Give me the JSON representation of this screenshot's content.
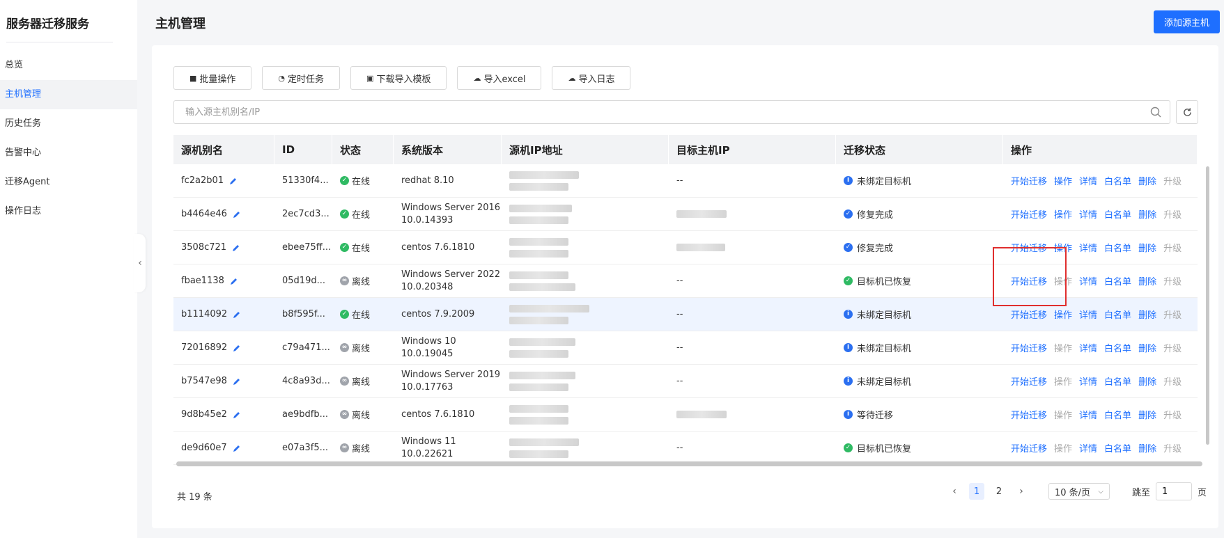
{
  "app_title": "服务器迁移服务",
  "sidebar": {
    "items": [
      {
        "label": "总览"
      },
      {
        "label": "主机管理"
      },
      {
        "label": "历史任务"
      },
      {
        "label": "告警中心"
      },
      {
        "label": "迁移Agent"
      },
      {
        "label": "操作日志"
      }
    ],
    "active_index": 1
  },
  "header": {
    "title": "主机管理",
    "add_button": "添加源主机"
  },
  "toolbar": {
    "batch": "批量操作",
    "schedule": "定时任务",
    "download_template": "下载导入模板",
    "import_excel": "导入excel",
    "import_log": "导入日志"
  },
  "search": {
    "placeholder": "输入源主机别名/IP",
    "value": ""
  },
  "table": {
    "columns": [
      "源机别名",
      "ID",
      "状态",
      "系统版本",
      "源机IP地址",
      "目标主机IP",
      "迁移状态",
      "操作"
    ],
    "ops": [
      "开始迁移",
      "操作",
      "详情",
      "白名单",
      "删除",
      "升级"
    ],
    "rows": [
      {
        "alias": "fc2a2b01",
        "id": "51330f4...",
        "status": "在线",
        "os": "redhat 8.10",
        "target_ip": "--",
        "mstatus": "未绑定目标机"
      },
      {
        "alias": "b4464e46",
        "id": "2ec7cd3...",
        "status": "在线",
        "os": "Windows Server 2016 10.0.14393",
        "target_ip": "",
        "mstatus": "修复完成"
      },
      {
        "alias": "3508c721",
        "id": "ebee75ff...",
        "status": "在线",
        "os": "centos 7.6.1810",
        "target_ip": "",
        "mstatus": "修复完成"
      },
      {
        "alias": "fbae1138",
        "id": "05d19d...",
        "status": "离线",
        "os": "Windows Server 2022 10.0.20348",
        "target_ip": "--",
        "mstatus": "目标机已恢复"
      },
      {
        "alias": "b1114092",
        "id": "b8f595f...",
        "status": "在线",
        "os": "centos 7.9.2009",
        "target_ip": "--",
        "mstatus": "未绑定目标机"
      },
      {
        "alias": "72016892",
        "id": "c79a471...",
        "status": "离线",
        "os": "Windows 10 10.0.19045",
        "target_ip": "--",
        "mstatus": "未绑定目标机"
      },
      {
        "alias": "b7547e98",
        "id": "4c8a93d...",
        "status": "离线",
        "os": "Windows Server 2019 10.0.17763",
        "target_ip": "--",
        "mstatus": "未绑定目标机"
      },
      {
        "alias": "9d8b45e2",
        "id": "ae9bdfb...",
        "status": "离线",
        "os": "centos 7.6.1810",
        "target_ip": "",
        "mstatus": "等待迁移"
      },
      {
        "alias": "de9d60e7",
        "id": "e07a3f5...",
        "status": "离线",
        "os": "Windows 11 10.0.22621",
        "target_ip": "--",
        "mstatus": "目标机已恢复"
      }
    ]
  },
  "pagination": {
    "total": "共 19 条",
    "pages": [
      "1",
      "2"
    ],
    "current": "1",
    "page_size": "10 条/页",
    "jump_label": "跳至",
    "jump_value": "1",
    "page_unit": "页"
  },
  "colors": {
    "primary": "#1e6fff",
    "online": "#2fba63",
    "offline": "#a0a4ab",
    "info": "#2b6ff0",
    "highlight_box": "#e02e2e"
  }
}
